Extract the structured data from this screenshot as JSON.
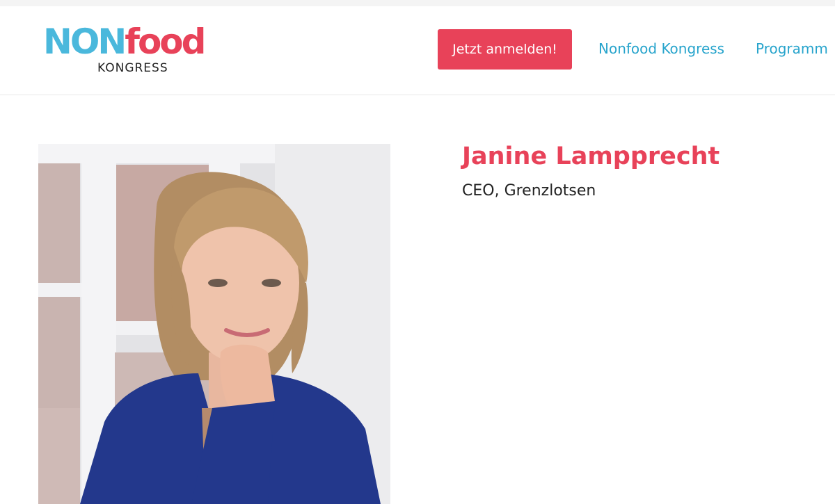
{
  "brand": {
    "logo_part1": "NON",
    "logo_part2": "food",
    "logo_sub": "KONGRESS",
    "color_blue": "#4ab8dc",
    "color_red": "#e84259"
  },
  "header": {
    "cta_label": "Jetzt anmelden!",
    "nav": [
      {
        "label": "Nonfood Kongress"
      },
      {
        "label": "Programm"
      }
    ],
    "link_color": "#27a4cc"
  },
  "speaker": {
    "name": "Janine Lampprecht",
    "role": "CEO, Grenzlotsen",
    "photo_icon": "speaker-portrait"
  }
}
